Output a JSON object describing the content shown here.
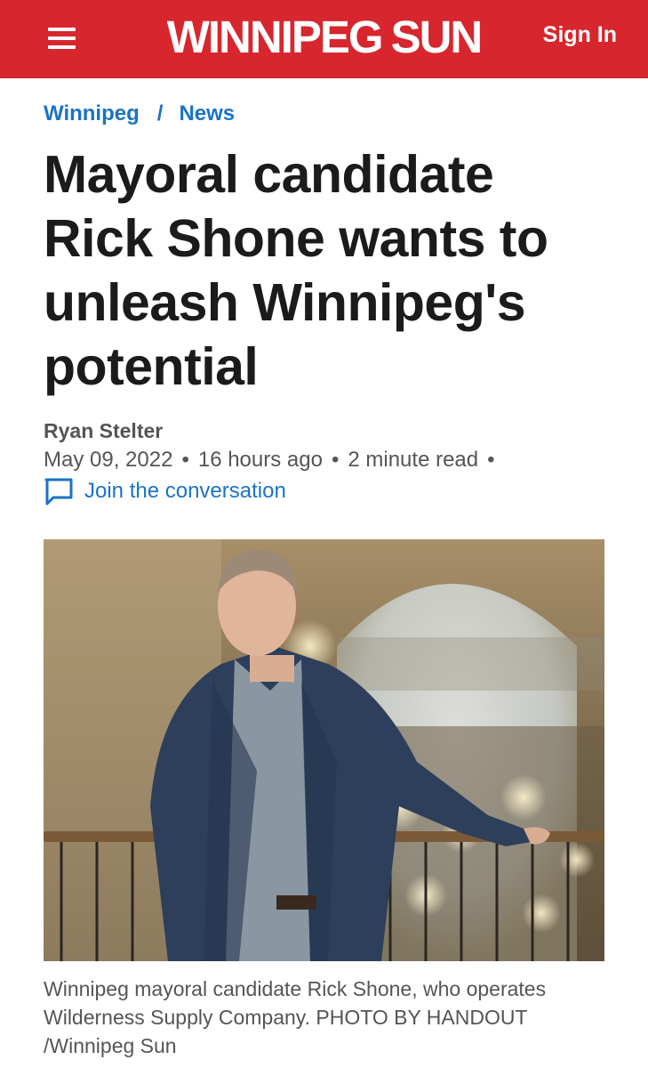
{
  "header": {
    "logo_part1": "WINNIPEG",
    "logo_part2": "SUN",
    "sign_in_label": "Sign In"
  },
  "breadcrumb": {
    "items": [
      "Winnipeg",
      "News"
    ],
    "separator": "/"
  },
  "article": {
    "headline": "Mayoral candidate Rick Shone wants to unleash Winnipeg's potential",
    "author": "Ryan Stelter",
    "date": "May 09, 2022",
    "relative_time": "16 hours ago",
    "read_time": "2 minute read",
    "meta_separator": "•",
    "conversation_label": "Join the conversation",
    "caption": "Winnipeg mayoral candidate Rick Shone, who operates Wilderness Supply Company. PHOTO BY HANDOUT /Winnipeg Sun"
  },
  "colors": {
    "brand_red": "#d7262e",
    "link_blue": "#1a73c7",
    "meta_gray": "#555555"
  },
  "icons": {
    "menu": "hamburger-menu-icon",
    "conversation": "speech-bubble-icon"
  }
}
